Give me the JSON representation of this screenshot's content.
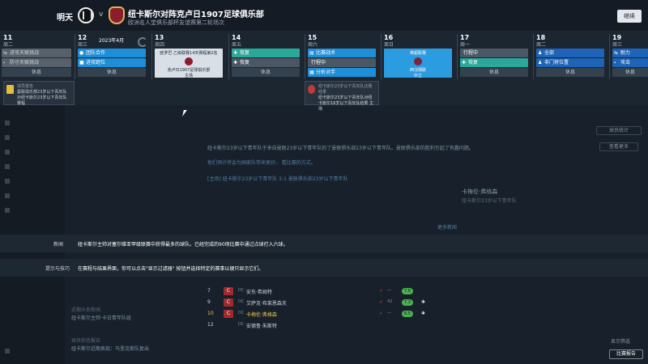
{
  "topbar": {
    "label_next": "明天",
    "separator": "v",
    "match_title": "纽卡斯尔对阵克卢日1907足球俱乐部",
    "match_subtitle": "欧洲名人堂俱乐部杯友谊赛第二轮场次",
    "continue_label": "继续"
  },
  "calendar": {
    "month_label": "2023年4月",
    "days": [
      {
        "num": "11",
        "week": "周二"
      },
      {
        "num": "12",
        "week": "周三"
      },
      {
        "num": "13",
        "week": "周四"
      },
      {
        "num": "14",
        "week": "周五"
      },
      {
        "num": "15",
        "week": "周六"
      },
      {
        "num": "16",
        "week": "周日"
      },
      {
        "num": "17",
        "week": "周一"
      },
      {
        "num": "18",
        "week": "周二"
      },
      {
        "num": "19",
        "week": "周三"
      }
    ],
    "day11": [
      "进攻天赋挑战",
      "防守天赋挑战",
      "休息"
    ],
    "day12": [
      "团队合作",
      "进攻跑位",
      "休息"
    ],
    "day13_match": {
      "line1": "欧罗巴 乙级联赛14天赛程第2名",
      "line2": "克卢日1907足球俱乐部",
      "line3": "主场"
    },
    "day14": [
      "恢复",
      "恢复",
      "休息"
    ],
    "day15": [
      "比赛战术",
      "行程中",
      "分析对手"
    ],
    "day16_match": {
      "line1": "英超联赛",
      "line2": "西汉姆联",
      "line3": "中立"
    },
    "day17": [
      "行程中",
      "恢复",
      "休息"
    ],
    "day18": [
      "全部",
      "非门将位置",
      "休息"
    ],
    "day19": [
      "耐力",
      "攻击",
      "休息"
    ]
  },
  "popcards": {
    "card1_title": "球员报告",
    "card1_text": "曼联俱乐部23岁以下青年队对纽卡斯尔23岁以下青年队赛程",
    "card2_title": "纽卡斯尔23岁以下青年队比赛结果",
    "card2_text": "纽卡斯尔23岁以下青年队对纽卡斯尔18岁以下青年队结果 主场"
  },
  "background": {
    "news_line": "纽卡斯尔23岁以下青年队于来自曼联23岁以下青年队的了曼联俱乐部23岁以下青年队。曼联俱乐部的胜利引起了有趣问题。",
    "news_line2": "他们预计将会为国家队带来更好、 看比赛的方式。",
    "table_head": "[主场] 纽卡斯尔23岁以下青年队 3-1 曼联俱乐部23岁以下青年队",
    "player_name": "卡梅伦·弗格森",
    "player_role": "纽卡斯尔23岁以下青年队",
    "more_link": "更多新闻"
  },
  "info": {
    "news_label": "新闻",
    "news_text": "纽卡斯尔主帅对塞尔维亚甲级联赛中获得最多的球队。已经完成的90场比赛中通过点球打入六球。",
    "tips_label": "提示与技巧",
    "tips_text": "在赛程与结果界面，你可以点击\"显示过滤器\" 按钮并选择特定的赛事以便只显示它们。"
  },
  "fixtures": [
    {
      "no": "7",
      "badge": "C",
      "pos": "DC",
      "name": "安东·希姆特",
      "stat": "—",
      "rating": "7.8"
    },
    {
      "no": "9",
      "badge": "C",
      "pos": "DC",
      "name": "艾萨克·布莱恩森夫",
      "stat": "42",
      "rating": "7.3"
    },
    {
      "no": "10",
      "badge": "C",
      "pos": "DC",
      "name": "卡梅伦·弗格森",
      "stat": "—",
      "rating": "8.5"
    },
    {
      "no": "12",
      "badge": "",
      "pos": "DC",
      "name": "安德鲁·朱斯特",
      "stat": "",
      "rating": ""
    }
  ],
  "left_feed": [
    {
      "title": "近期头条新闻",
      "text": "纽卡斯尔主帅·卡日青年队组"
    },
    {
      "title": "球员状态报告",
      "text": "纽卡斯尔近期表现：马里克斯队复出"
    }
  ],
  "buttons": {
    "report_label": "比赛报告",
    "filter_label": "显示筛选",
    "view_label": "查看更多",
    "stats_label": "球员统计"
  }
}
